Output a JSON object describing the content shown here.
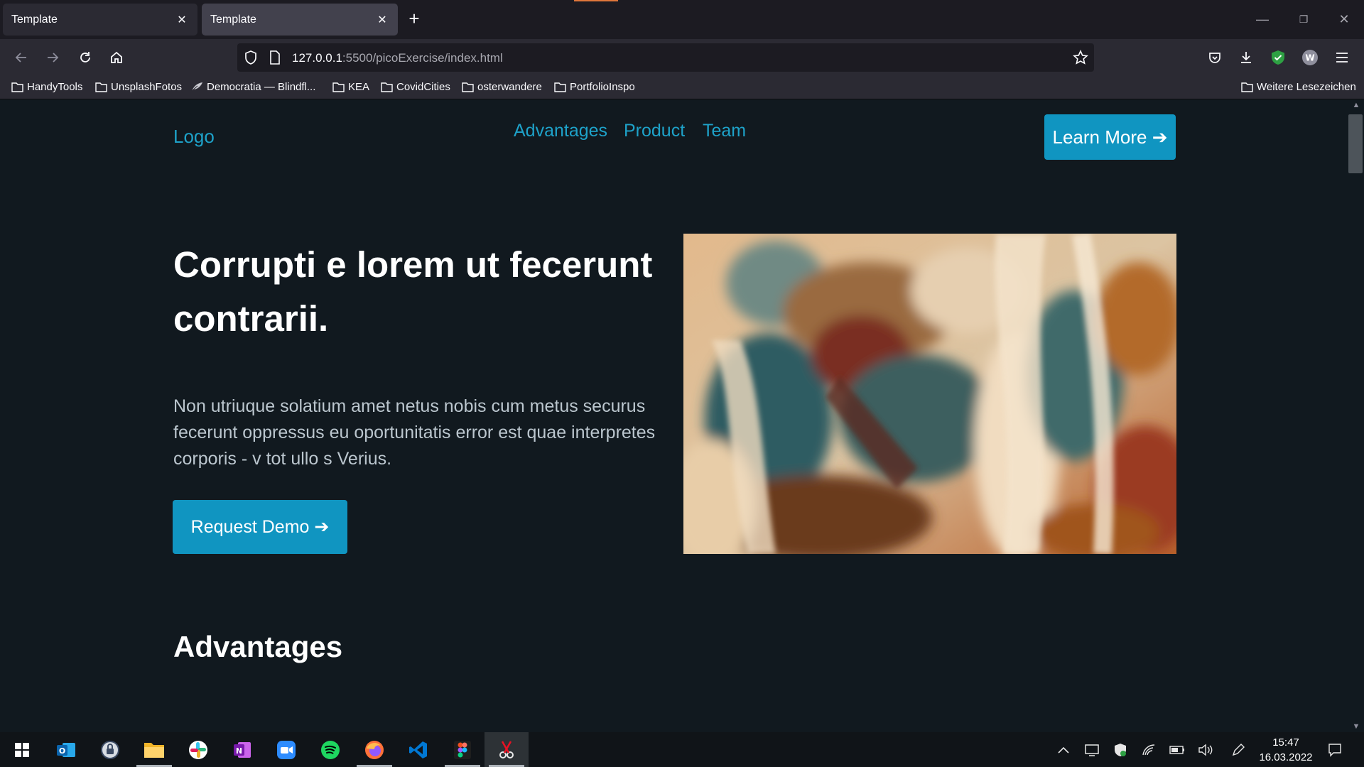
{
  "browser": {
    "tabs": [
      {
        "title": "Template",
        "close": "✕"
      },
      {
        "title": "Template",
        "close": "✕"
      }
    ],
    "new_tab": "+",
    "url_host": "127.0.0.1",
    "url_rest": ":5500/picoExercise/index.html",
    "bookmarks": [
      "HandyTools",
      "UnsplashFotos",
      "Democratia — Blindfl...",
      "KEA",
      "CovidCities",
      "osterwandere",
      "PortfolioInspo"
    ],
    "other_bookmarks": "Weitere Lesezeichen",
    "profile_initial": "W",
    "window_controls": {
      "minimize": "—",
      "restore": "❐",
      "close": "✕"
    }
  },
  "site": {
    "logo": "Logo",
    "nav": [
      "Advantages",
      "Product",
      "Team"
    ],
    "cta": "Learn More ➔",
    "hero": {
      "title": "Corrupti e lorem ut fecerunt contrarii.",
      "text": "Non utriuque solatium amet netus nobis cum metus securus fecerunt oppressus eu oportunitatis error est quae interpretes corporis - v tot ullo s Verius.",
      "button": "Request Demo ➔"
    },
    "section_heading": "Advantages",
    "accent_color": "#1095c1",
    "background_color": "#11191f"
  },
  "taskbar": {
    "apps": [
      "windows-start",
      "outlook",
      "password-manager",
      "file-explorer",
      "slack",
      "onenote",
      "zoom",
      "spotify",
      "firefox",
      "vscode",
      "figma",
      "snipping-tool"
    ],
    "time": "15:47",
    "date": "16.03.2022"
  }
}
